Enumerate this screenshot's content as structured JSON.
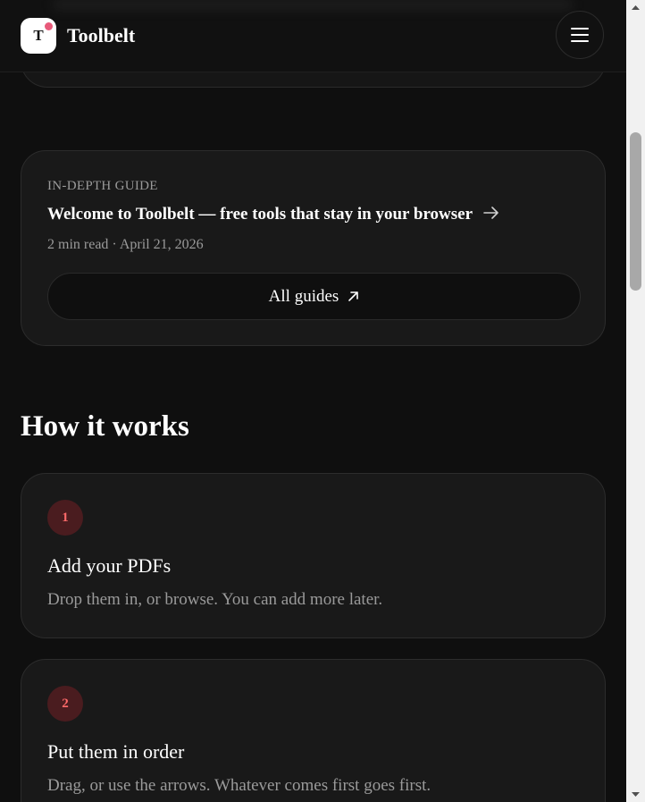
{
  "header": {
    "brand": "Toolbelt",
    "logo_letter": "T",
    "menu_icon": "hamburger-icon"
  },
  "guide": {
    "eyebrow": "IN-DEPTH GUIDE",
    "title": "Welcome to Toolbelt — free tools that stay in your browser",
    "meta": "2 min read · April 21, 2026",
    "all_guides_label": "All guides"
  },
  "how_it_works": {
    "title": "How it works",
    "steps": [
      {
        "number": "1",
        "title": "Add your PDFs",
        "description": "Drop them in, or browse. You can add more later."
      },
      {
        "number": "2",
        "title": "Put them in order",
        "description": "Drag, or use the arrows. Whatever comes first goes first."
      }
    ]
  },
  "colors": {
    "background": "#0f0f0f",
    "card": "#191919",
    "accent": "#ff6a6a",
    "accent_bg": "#4a1c1f",
    "logo_dot": "#e85a7a"
  }
}
